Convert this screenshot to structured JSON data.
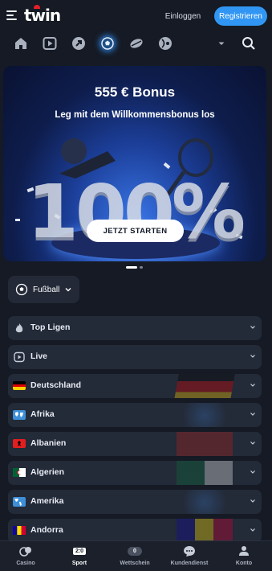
{
  "header": {
    "login_label": "Einloggen",
    "register_label": "Registrieren",
    "brand_color": "#3196f3"
  },
  "sport_nav": {
    "icons": [
      "home-icon",
      "live-play-icon",
      "up-arrow-icon",
      "soccer-ball-icon",
      "ice-hockey-puck-icon",
      "tennis-icon",
      "chevron-down-icon",
      "search-icon"
    ],
    "active": "soccer-ball-icon"
  },
  "banner": {
    "title": "555 € Bonus",
    "subtitle": "Leg mit dem Willkommensbonus los",
    "big_text": "100%",
    "cta_label": "JETZT STARTEN"
  },
  "carousel": {
    "total": 2,
    "active_index": 0
  },
  "sport_select": {
    "label": "Fußball"
  },
  "categories": [
    {
      "label": "Top Ligen",
      "icon": "fire-icon"
    },
    {
      "label": "Live",
      "icon": "live-play-icon"
    },
    {
      "label": "Deutschland",
      "icon": "flag-germany-icon"
    },
    {
      "label": "Afrika",
      "icon": "world-map-icon"
    },
    {
      "label": "Albanien",
      "icon": "flag-albania-icon"
    },
    {
      "label": "Algerien",
      "icon": "flag-algeria-icon"
    },
    {
      "label": "Amerika",
      "icon": "world-map-icon"
    },
    {
      "label": "Andorra",
      "icon": "flag-andorra-icon"
    }
  ],
  "bottom_nav": {
    "casino": "Casino",
    "sport": "Sport",
    "sport_badge": "2:0",
    "betslip": "Wettschein",
    "betslip_count": "0",
    "support": "Kundendienst",
    "account": "Konto"
  }
}
